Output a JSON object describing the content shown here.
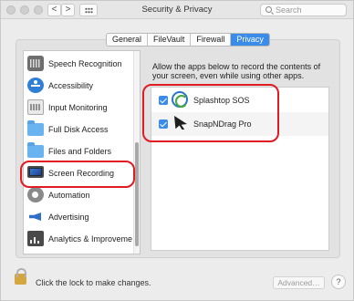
{
  "window": {
    "title": "Security & Privacy",
    "back_glyph": "<",
    "forward_glyph": ">"
  },
  "search": {
    "placeholder": "Search"
  },
  "tabs": [
    {
      "label": "General",
      "active": false
    },
    {
      "label": "FileVault",
      "active": false
    },
    {
      "label": "Firewall",
      "active": false
    },
    {
      "label": "Privacy",
      "active": true
    }
  ],
  "sidebar": {
    "items": [
      {
        "label": "Speech Recognition",
        "icon": "speech-recognition-icon"
      },
      {
        "label": "Accessibility",
        "icon": "accessibility-icon"
      },
      {
        "label": "Input Monitoring",
        "icon": "keyboard-icon"
      },
      {
        "label": "Full Disk Access",
        "icon": "folder-icon"
      },
      {
        "label": "Files and Folders",
        "icon": "folder-icon"
      },
      {
        "label": "Screen Recording",
        "icon": "monitor-icon",
        "selected": true
      },
      {
        "label": "Automation",
        "icon": "gear-icon"
      },
      {
        "label": "Advertising",
        "icon": "megaphone-icon"
      },
      {
        "label": "Analytics & Improveme…",
        "icon": "analytics-icon"
      }
    ]
  },
  "main": {
    "description": "Allow the apps below to record the contents of your screen, even while using other apps.",
    "apps": [
      {
        "name": "Splashtop SOS",
        "checked": true,
        "icon": "splashtop-icon"
      },
      {
        "name": "SnapNDrag Pro",
        "checked": true,
        "icon": "snapndrag-icon"
      }
    ]
  },
  "footer": {
    "lock_text": "Click the lock to make changes.",
    "advanced_label": "Advanced…",
    "help_label": "?"
  },
  "colors": {
    "accent": "#3b8be9",
    "annotation_red": "#e11b22"
  }
}
